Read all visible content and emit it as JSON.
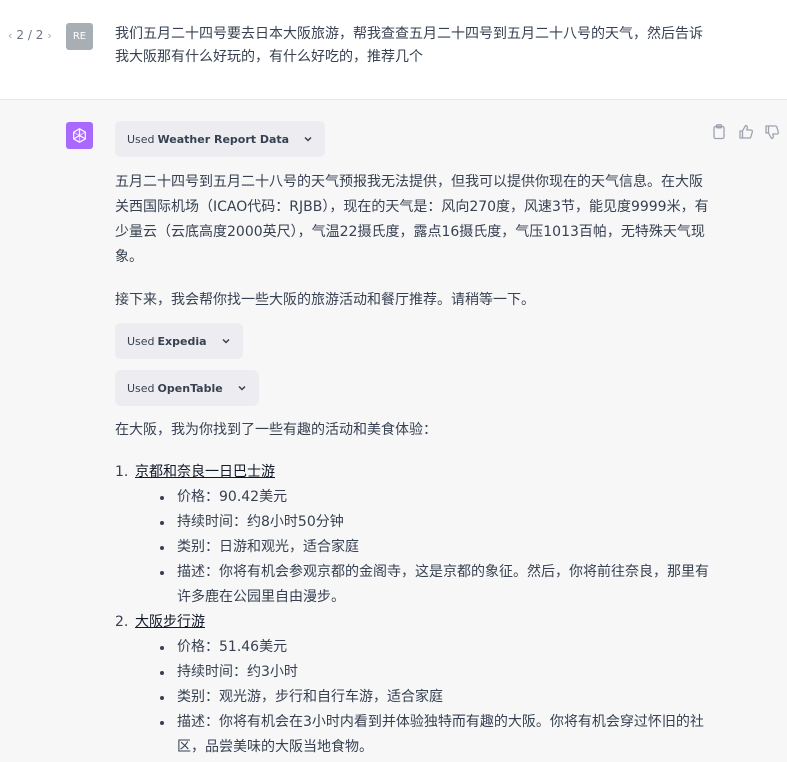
{
  "pager": {
    "current": "2 / 2",
    "prev_icon": "chevron-left-icon",
    "next_icon": "chevron-right-icon"
  },
  "user": {
    "avatar_initials": "RE",
    "message": "我们五月二十四号要去日本大阪旅游，帮我查查五月二十四号到五月二十八号的天气，然后告诉我大阪那有什么好玩的，有什么好吃的，推荐几个"
  },
  "assistant": {
    "avatar_color": "#ab68ff",
    "plugins": [
      {
        "prefix": "Used",
        "name": "Weather Report Data"
      },
      {
        "prefix": "Used",
        "name": "Expedia"
      },
      {
        "prefix": "Used",
        "name": "OpenTable"
      }
    ],
    "paragraph1": "五月二十四号到五月二十八号的天气预报我无法提供，但我可以提供你现在的天气信息。在大阪关西国际机场（ICAO代码：RJBB），现在的天气是：风向270度，风速3节，能见度9999米，有少量云（云底高度2000英尺），气温22摄氏度，露点16摄氏度，气压1013百帕，无特殊天气现象。",
    "paragraph2": "接下来，我会帮你找一些大阪的旅游活动和餐厅推荐。请稍等一下。",
    "paragraph3": "在大阪，我为你找到了一些有趣的活动和美食体验：",
    "items": [
      {
        "num": "1.",
        "title": "京都和奈良一日巴士游",
        "details": [
          "价格：90.42美元",
          "持续时间：约8小时50分钟",
          "类别：日游和观光，适合家庭",
          "描述：你将有机会参观京都的金阁寺，这是京都的象征。然后，你将前往奈良，那里有许多鹿在公园里自由漫步。"
        ]
      },
      {
        "num": "2.",
        "title": "大阪步行游",
        "details": [
          "价格：51.46美元",
          "持续时间：约3小时",
          "类别：观光游，步行和自行车游，适合家庭",
          "描述：你将有机会在3小时内看到并体验独特而有趣的大阪。你将有机会穿过怀旧的社区，品尝美味的大阪当地食物。"
        ]
      }
    ]
  },
  "colors": {
    "accent": "#ab68ff",
    "pill_bg": "#ececf1",
    "assistant_bg": "#f7f7f8"
  }
}
